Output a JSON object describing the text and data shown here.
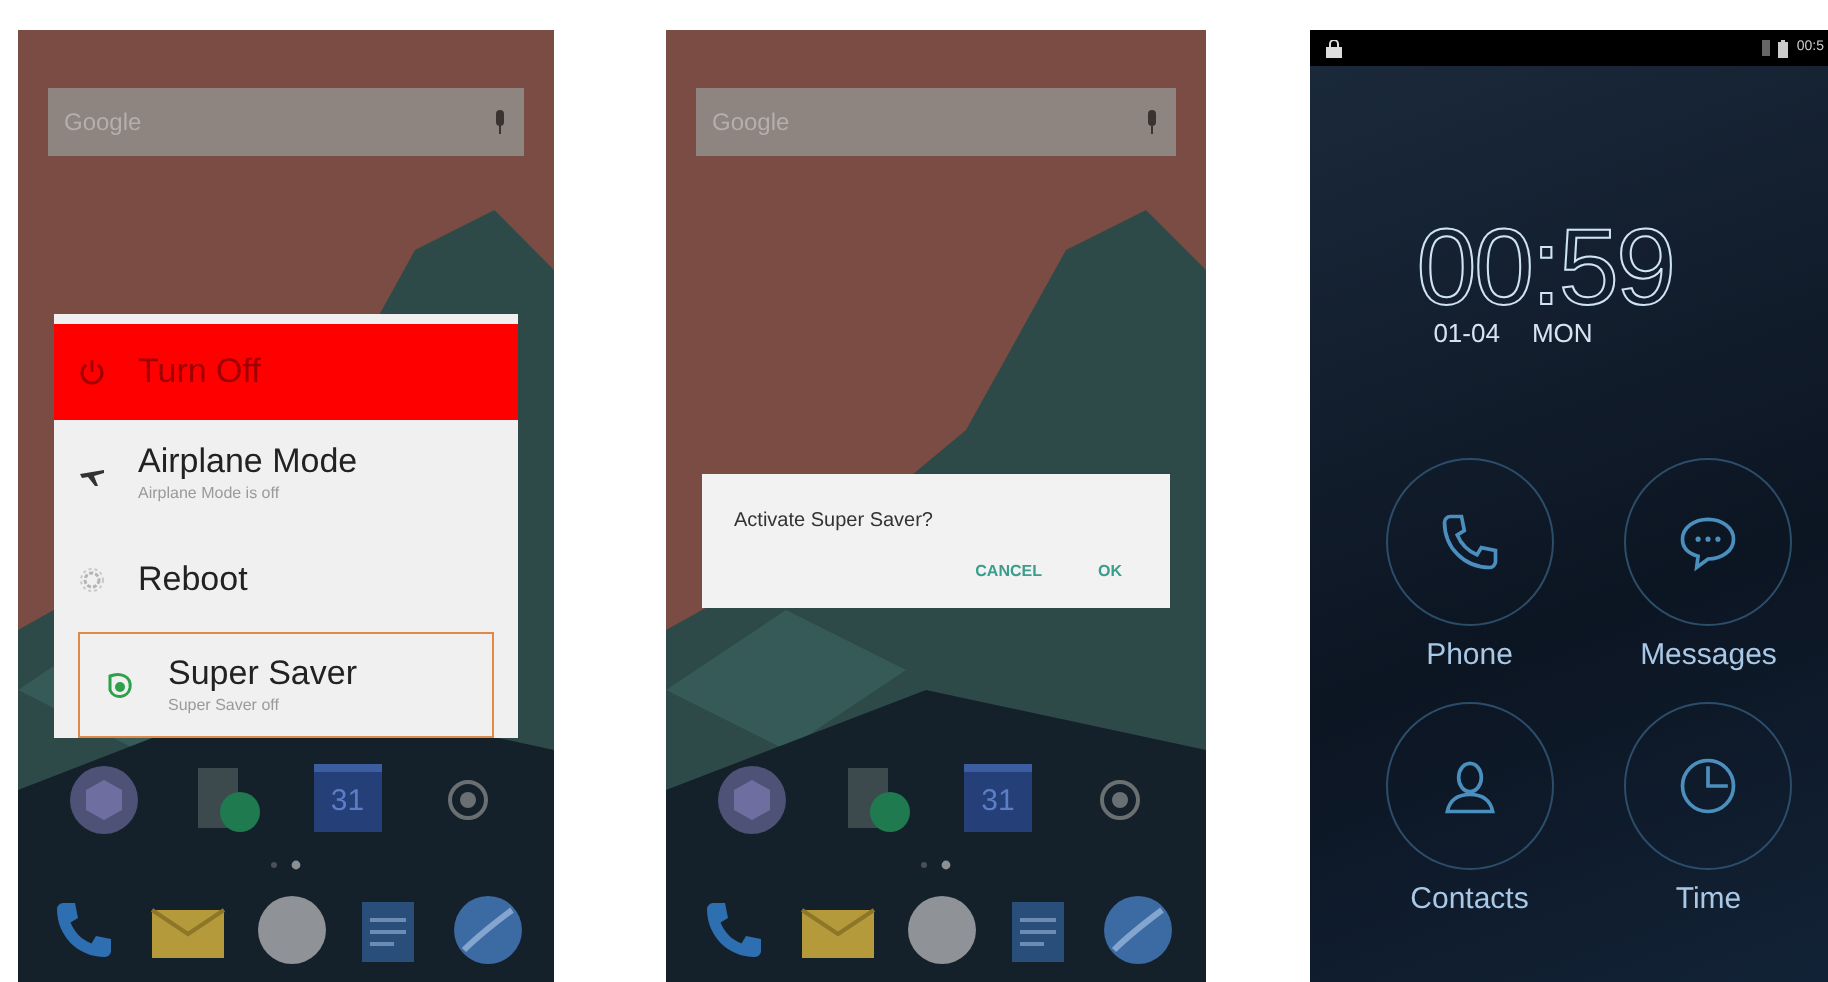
{
  "screens": [
    {
      "kind": "menu",
      "search": {
        "logo": "Google"
      },
      "menu": [
        {
          "title": "Turn Off",
          "selected": true,
          "highlighted": false
        },
        {
          "title": "Airplane Mode",
          "subtitle": "Airplane Mode is off",
          "selected": false,
          "highlighted": false
        },
        {
          "title": "Reboot",
          "selected": false,
          "highlighted": false
        },
        {
          "title": "Super Saver",
          "subtitle": "Super Saver off",
          "selected": false,
          "highlighted": true
        }
      ],
      "calendar_day": "31"
    },
    {
      "kind": "dialog",
      "search": {
        "logo": "Google"
      },
      "dialog": {
        "message": "Activate Super Saver?",
        "buttons": [
          "CANCEL",
          "OK"
        ]
      },
      "calendar_day": "31"
    },
    {
      "kind": "lock",
      "status_time": "00:5",
      "clock": "00:59",
      "date": "01-04",
      "weekday": "MON",
      "shortcuts": [
        "Phone",
        "Messages",
        "Contacts",
        "Time"
      ]
    }
  ]
}
